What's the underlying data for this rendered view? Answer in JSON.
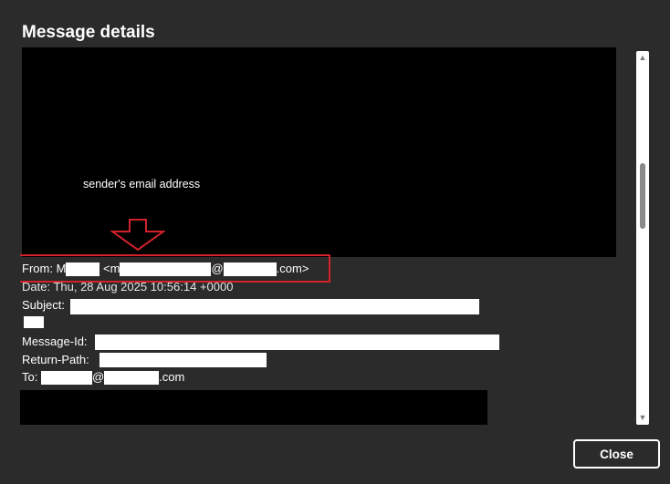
{
  "dialog": {
    "title": "Message details",
    "close_label": "Close"
  },
  "annotation": {
    "label": "sender's email address",
    "arrow_icon": "down-arrow-icon",
    "highlight_color": "#d0222a"
  },
  "headers": {
    "from_label": "From:",
    "from_name_initial": "M",
    "from_open": "<m",
    "from_at": "@",
    "from_domain_suffix": ".com>",
    "date_text": "Date: Thu, 28 Aug 2025 10:56:14 +0000",
    "subject_label": "Subject:",
    "message_id_label": "Message-Id:",
    "return_path_label": "Return-Path:",
    "to_label": "To:",
    "to_at": "@",
    "to_domain_suffix": ".com"
  },
  "scrollbar": {
    "up_icon": "scroll-up-arrow-icon",
    "down_icon": "scroll-down-arrow-icon"
  }
}
